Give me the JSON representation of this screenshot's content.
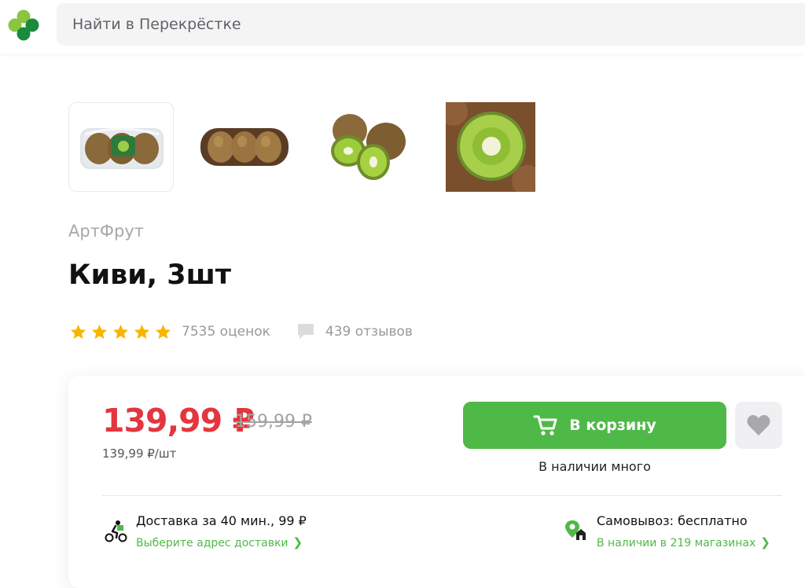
{
  "header": {
    "search_placeholder": "Найти в Перекрёстке"
  },
  "colors": {
    "brand_green": "#4fb948",
    "logo_green_light": "#8bc53f",
    "logo_green_dark": "#1a8a3d",
    "price_red": "#e3363e",
    "star_yellow": "#f7b500"
  },
  "gallery": {
    "images": [
      {
        "name": "kiwi-packaged-tray",
        "selected": true
      },
      {
        "name": "kiwi-open-tray"
      },
      {
        "name": "kiwi-halves"
      },
      {
        "name": "kiwi-cross-section"
      }
    ]
  },
  "product": {
    "brand": "АртФрут",
    "title": "Киви, 3шт",
    "rating": 5,
    "ratings_count": "7535 оценок",
    "reviews_count": "439 отзывов"
  },
  "purchase": {
    "price": "139,99 ₽",
    "old_price": "159,99 ₽",
    "unit_price": "139,99 ₽/шт",
    "add_to_cart_label": "В корзину",
    "stock_status": "В наличии много",
    "delivery": {
      "title": "Доставка за 40 мин., 99 ₽",
      "link": "Выберите адрес доставки"
    },
    "pickup": {
      "title": "Самовывоз: бесплатно",
      "link": "В наличии в 219 магазинах"
    }
  }
}
